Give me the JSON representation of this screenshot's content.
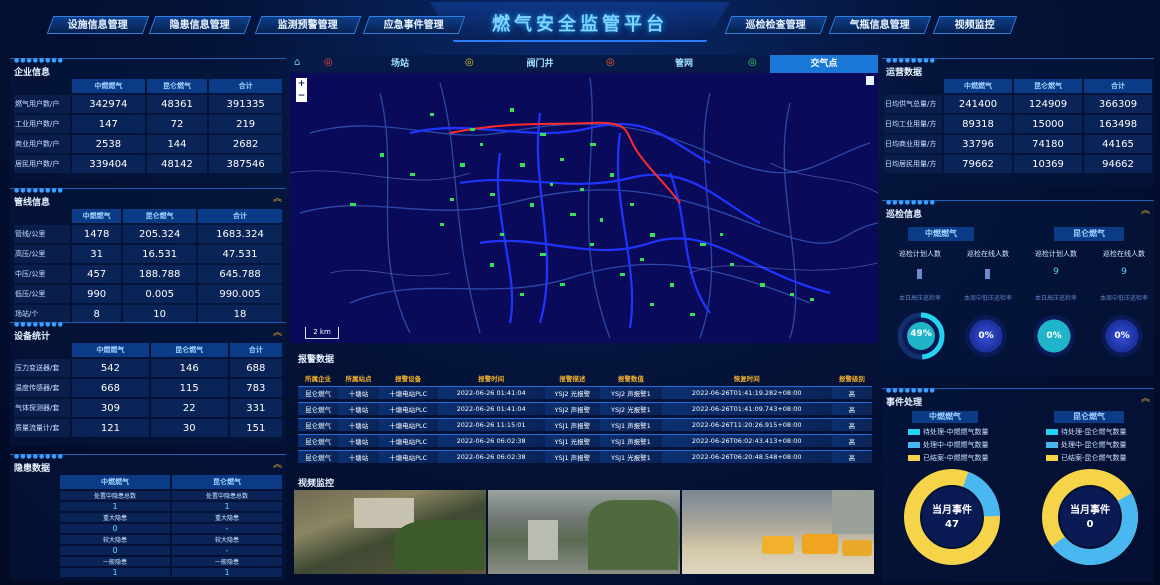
{
  "title": "燃气安全监管平台",
  "nav_left": [
    "设施信息管理",
    "隐患信息管理",
    "监测预警管理",
    "应急事件管理"
  ],
  "nav_right": [
    "巡检检查管理",
    "气瓶信息管理",
    "视频监控"
  ],
  "enterprise": {
    "title": "企业信息",
    "headers": [
      "中燃燃气",
      "昆仑燃气",
      "合计"
    ],
    "rows": [
      {
        "label": "燃气用户数/户",
        "v": [
          "342974",
          "48361",
          "391335"
        ]
      },
      {
        "label": "工业用户数/户",
        "v": [
          "147",
          "72",
          "219"
        ]
      },
      {
        "label": "商业用户数/户",
        "v": [
          "2538",
          "144",
          "2682"
        ]
      },
      {
        "label": "居民用户数/户",
        "v": [
          "339404",
          "48142",
          "387546"
        ]
      }
    ]
  },
  "pipeline": {
    "title": "管线信息",
    "headers": [
      "中燃燃气",
      "昆仑燃气",
      "合计"
    ],
    "rows": [
      {
        "label": "管线/公里",
        "v": [
          "1478",
          "205.324",
          "1683.324"
        ]
      },
      {
        "label": "高压/公里",
        "v": [
          "31",
          "16.531",
          "47.531"
        ]
      },
      {
        "label": "中压/公里",
        "v": [
          "457",
          "188.788",
          "645.788"
        ]
      },
      {
        "label": "低压/公里",
        "v": [
          "990",
          "0.005",
          "990.005"
        ]
      },
      {
        "label": "场站/个",
        "v": [
          "8",
          "10",
          "18"
        ]
      }
    ]
  },
  "equipment": {
    "title": "设备统计",
    "headers": [
      "中燃燃气",
      "昆仑燃气",
      "合计"
    ],
    "rows": [
      {
        "label": "压力变送器/套",
        "v": [
          "542",
          "146",
          "688"
        ]
      },
      {
        "label": "温度传感器/套",
        "v": [
          "668",
          "115",
          "783"
        ]
      },
      {
        "label": "气体探测器/套",
        "v": [
          "309",
          "22",
          "331"
        ]
      },
      {
        "label": "质量流量计/套",
        "v": [
          "121",
          "30",
          "151"
        ]
      }
    ]
  },
  "hazard": {
    "title": "隐患数据",
    "headers": [
      "中燃燃气",
      "昆仑燃气"
    ],
    "rows": [
      {
        "label": "处置中隐患总数",
        "v": [
          "1",
          "1"
        ]
      },
      {
        "label": "重大隐患",
        "v": [
          "0",
          "-"
        ]
      },
      {
        "label": "较大隐患",
        "v": [
          "0",
          "-"
        ]
      },
      {
        "label": "一般隐患",
        "v": [
          "1",
          "1"
        ]
      }
    ]
  },
  "tabs": [
    "场站",
    "阀门井",
    "管网",
    "交气点"
  ],
  "map": {
    "scale": "2 km"
  },
  "alarm": {
    "title": "报警数据",
    "headers": [
      "所属企业",
      "所属站点",
      "报警设备",
      "报警时间",
      "报警描述",
      "报警数值",
      "恢复时间",
      "报警级别"
    ],
    "rows": [
      [
        "昆仑燃气",
        "十塘站",
        "十塘电站PLC",
        "2022-06-26 01:41:04",
        "YSJ2 光报警",
        "YSJ2 声报警1",
        "2022-06-26T01:41:19.282+08:00",
        "高"
      ],
      [
        "昆仑燃气",
        "十塘站",
        "十塘电站PLC",
        "2022-06-26 01:41:04",
        "YSJ2 声报警",
        "YSJ2 光报警1",
        "2022-06-26T01:41:09.743+08:00",
        "高"
      ],
      [
        "昆仑燃气",
        "十塘站",
        "十塘电站PLC",
        "2022-06-26 11:15:01",
        "YSJ1 声报警",
        "YSJ1 声报警1",
        "2022-06-26T11:20:26.915+08:00",
        "高"
      ],
      [
        "昆仑燃气",
        "十塘站",
        "十塘电站PLC",
        "2022-06-26 06:02:38",
        "YSJ1 光报警",
        "YSJ1 声报警1",
        "2022-06-26T06:02:43.413+08:00",
        "高"
      ],
      [
        "昆仑燃气",
        "十塘站",
        "十塘电站PLC",
        "2022-06-26 06:02:38",
        "YSJ1 声报警",
        "YSJ1 光报警1",
        "2022-06-26T06:20:48.548+08:00",
        "高"
      ]
    ]
  },
  "video": {
    "title": "视频监控"
  },
  "operation": {
    "title": "运营数据",
    "headers": [
      "中燃燃气",
      "昆仑燃气",
      "合计"
    ],
    "rows": [
      {
        "label": "日均供气总量/方",
        "v": [
          "241400",
          "124909",
          "366309"
        ]
      },
      {
        "label": "日均工业用量/方",
        "v": [
          "89318",
          "15000",
          "163498"
        ]
      },
      {
        "label": "日均商业用量/方",
        "v": [
          "33796",
          "74180",
          "44165"
        ]
      },
      {
        "label": "日均居民用量/方",
        "v": [
          "79662",
          "10369",
          "94662"
        ]
      }
    ]
  },
  "patrol": {
    "title": "巡检信息",
    "groups": [
      "中燃燃气",
      "昆仑燃气"
    ],
    "labels": [
      "巡检计划人数",
      "巡检在线人数",
      "巡检计划人数",
      "巡检在线人数"
    ],
    "values": [
      "",
      "",
      "9",
      "9"
    ],
    "sub": [
      "本日高压巡检率",
      "本周中低压巡检率",
      "本日高压巡检率",
      "本周中低压巡检率"
    ],
    "rates": [
      "49%",
      "0%",
      "0%",
      "0%"
    ],
    "rate_values": [
      49,
      0,
      0,
      0
    ]
  },
  "events": {
    "title": "事件处理",
    "groups": [
      "中燃燃气",
      "昆仑燃气"
    ],
    "legend_left": [
      "待处理-中燃燃气数量",
      "处理中-中燃燃气数量",
      "已结案-中燃燃气数量"
    ],
    "legend_right": [
      "待处理-昆仑燃气数量",
      "处理中-昆仑燃气数量",
      "已结案-昆仑燃气数量"
    ],
    "donut_label": "当月事件",
    "donut_values": [
      "47",
      "0"
    ]
  },
  "colors": {
    "accent": "#2a7bff",
    "warn": "#f0b12c",
    "cyan": "#23d4f0",
    "pie_yellow": "#f5d44a",
    "pie_blue": "#49b8f0"
  }
}
